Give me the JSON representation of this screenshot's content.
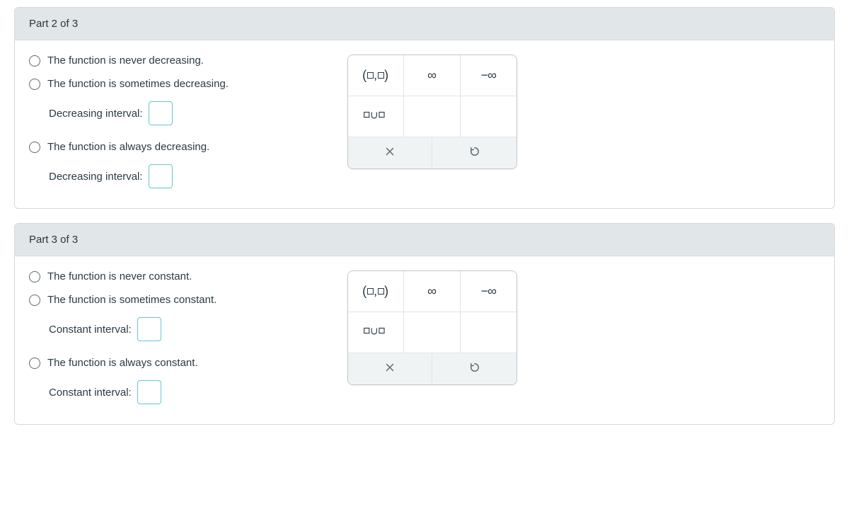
{
  "part2": {
    "header": "Part 2 of 3",
    "opt_never": "The function is never decreasing.",
    "opt_sometimes": "The function is sometimes decreasing.",
    "interval_label_a": "Decreasing interval:",
    "opt_always": "The function is always decreasing.",
    "interval_label_b": "Decreasing interval:"
  },
  "part3": {
    "header": "Part 3 of 3",
    "opt_never": "The function is never constant.",
    "opt_sometimes": "The function is sometimes constant.",
    "interval_label_a": "Constant interval:",
    "opt_always": "The function is always constant.",
    "interval_label_b": "Constant interval:"
  },
  "palette": {
    "inf": "∞",
    "neg_inf": "−∞"
  }
}
